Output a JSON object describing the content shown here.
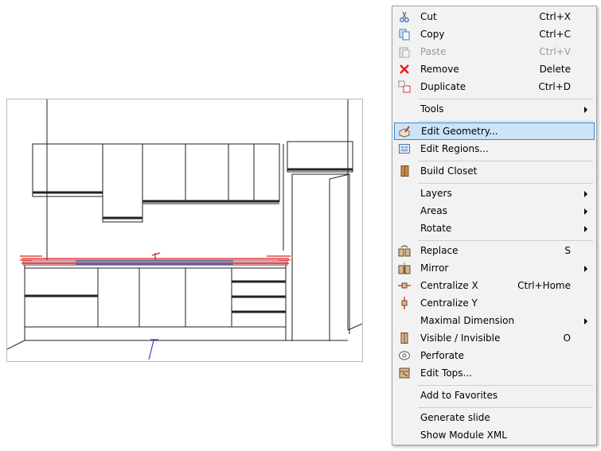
{
  "menu": {
    "items": [
      {
        "label": "Cut",
        "shortcut": "Ctrl+X",
        "icon": "scissors-icon",
        "disabled": false
      },
      {
        "label": "Copy",
        "shortcut": "Ctrl+C",
        "icon": "copy-icon",
        "disabled": false
      },
      {
        "label": "Paste",
        "shortcut": "Ctrl+V",
        "icon": "paste-icon",
        "disabled": true
      },
      {
        "label": "Remove",
        "shortcut": "Delete",
        "icon": "remove-x-icon",
        "disabled": false
      },
      {
        "label": "Duplicate",
        "shortcut": "Ctrl+D",
        "icon": "duplicate-icon",
        "disabled": false
      },
      {
        "label": "Tools",
        "submenu": true
      },
      {
        "label": "Edit Geometry...",
        "icon": "edit-geometry-icon",
        "highlighted": true
      },
      {
        "label": "Edit Regions...",
        "icon": "edit-regions-icon"
      },
      {
        "label": "Build Closet",
        "icon": "build-closet-icon"
      },
      {
        "label": "Layers",
        "submenu": true
      },
      {
        "label": "Areas",
        "submenu": true
      },
      {
        "label": "Rotate",
        "submenu": true
      },
      {
        "label": "Replace",
        "shortcut": "S",
        "icon": "replace-icon"
      },
      {
        "label": "Mirror",
        "submenu": true,
        "icon": "mirror-icon"
      },
      {
        "label": "Centralize X",
        "shortcut": "Ctrl+Home",
        "icon": "centralize-x-icon"
      },
      {
        "label": "Centralize Y",
        "icon": "centralize-y-icon"
      },
      {
        "label": "Maximal Dimension",
        "submenu": true
      },
      {
        "label": "Visible / Invisible",
        "shortcut": "O",
        "icon": "visible-icon"
      },
      {
        "label": "Perforate",
        "icon": "perforate-icon"
      },
      {
        "label": "Edit Tops...",
        "icon": "edit-tops-icon"
      },
      {
        "label": "Add to Favorites"
      },
      {
        "label": "Generate slide"
      },
      {
        "label": "Show Module XML"
      }
    ]
  },
  "colors": {
    "highlight_bg": "#cce4f7",
    "highlight_border": "#3d89cf",
    "selection_blue": "#7f8fd6",
    "handle_red": "#e0201c"
  }
}
